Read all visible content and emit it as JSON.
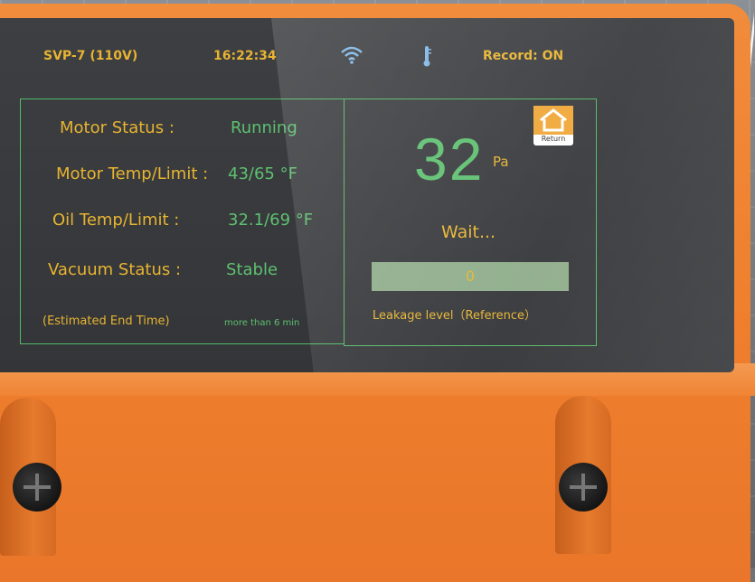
{
  "status_bar": {
    "device": "SVP-7 (110V)",
    "time": "16:22:34",
    "wifi_icon": "wifi-icon",
    "thermometer_icon": "thermometer-icon",
    "record": "Record: ON"
  },
  "left_panel": {
    "motor_status_label": "Motor Status :",
    "motor_status_value": "Running",
    "motor_temp_label": "Motor Temp/Limit :",
    "motor_temp_value": "43/65 °F",
    "oil_temp_label": "Oil Temp/Limit :",
    "oil_temp_value": "32.1/69 °F",
    "vacuum_status_label": "Vacuum Status :",
    "vacuum_status_value": "Stable",
    "end_time_label": "(Estimated End Time)",
    "end_time_value": "more than 6 min"
  },
  "right_panel": {
    "pressure_value": "32",
    "pressure_unit": "Pa",
    "state_text": "Wait...",
    "leakage_value": "0",
    "leakage_label": "Leakage level（Reference）",
    "return_label": "Return"
  },
  "colors": {
    "housing": "#ef7f2d",
    "screen": "#3a3c3f",
    "label_yellow": "#e8b431",
    "value_green": "#5ec070",
    "panel_border": "#55b968"
  }
}
